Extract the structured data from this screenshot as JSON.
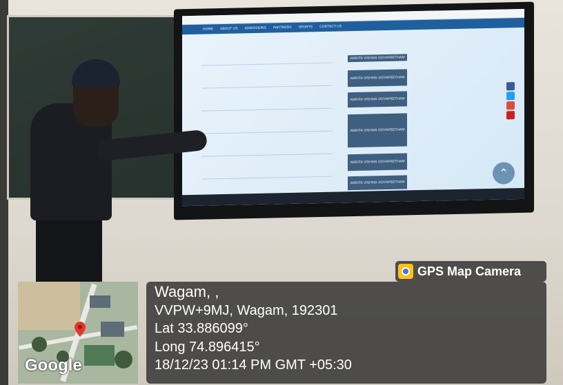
{
  "overlay": {
    "app_name": "GPS Map Camera",
    "map_attribution": "Google",
    "place": "Wagam, ,",
    "address": "VVPW+9MJ, Wagam, 192301",
    "lat": "Lat 33.886099°",
    "long": "Long 74.896415°",
    "datetime": "18/12/23 01:14 PM GMT +05:30"
  },
  "screen": {
    "nav_items": [
      "HOME",
      "ABOUT US",
      "ADMISSIONS",
      "PARTNERS",
      "SPORTS",
      "CONTACT US"
    ],
    "ad_label": "AMRITA VISHWA VIDYAPEETHAM"
  },
  "colors": {
    "overlay_bg": "#373737",
    "badge_icon": "#ffc21a",
    "pin": "#e5352b"
  }
}
